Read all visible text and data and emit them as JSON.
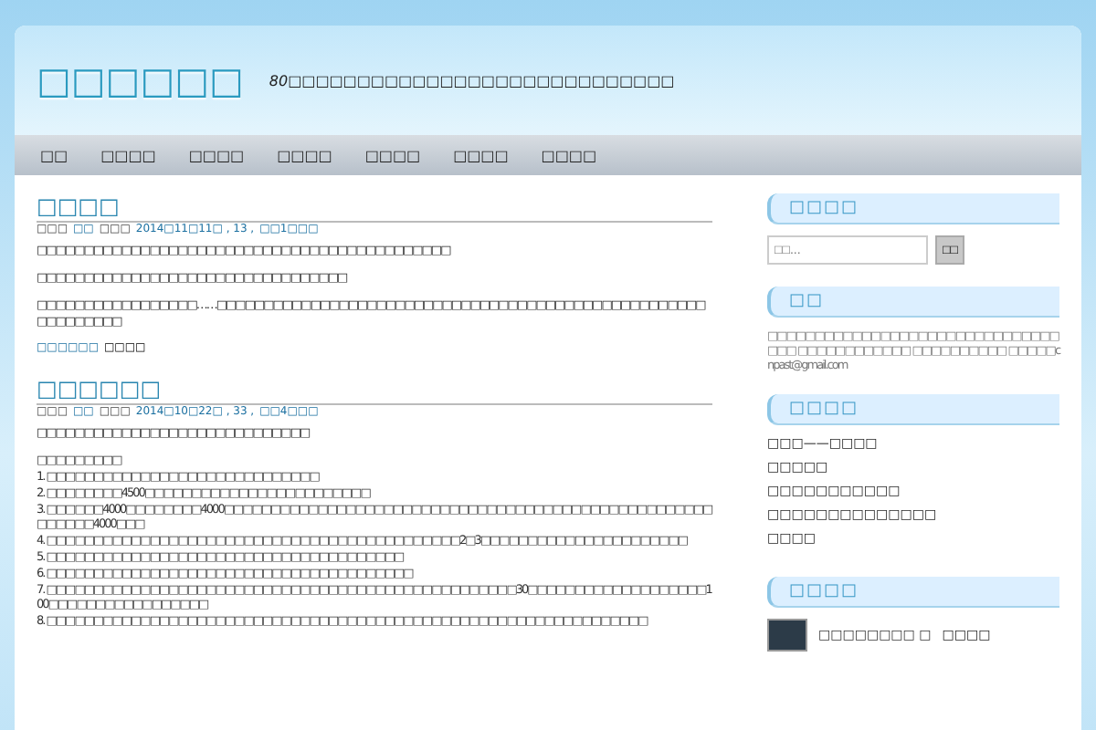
{
  "site": {
    "title": "□□□□□□",
    "tagline": "80□□□□□□□□□□□□□□□□□□□□□□□□□□□□"
  },
  "nav": [
    {
      "label": "□□",
      "selected": false
    },
    {
      "label": "□□□□",
      "selected": false
    },
    {
      "label": "□□□□",
      "selected": false
    },
    {
      "label": "□□□□",
      "selected": false
    },
    {
      "label": "□□□□",
      "selected": false
    },
    {
      "label": "□□□□",
      "selected": false
    },
    {
      "label": "□□□□",
      "selected": false
    }
  ],
  "posts": [
    {
      "title": "□□□□",
      "meta": {
        "by": "□□□",
        "author": "□□",
        "on": "□□□",
        "date": "2014□11□11□ , 13 ,",
        "comments": "□□1□□□"
      },
      "paragraphs": [
        "□□□□□□□□□□□□□□□□□□□□□□□□□□□□□□□□□□□□□□□□□□□□",
        "□□□□□□□□□□□□□□□□□□□□□□□□□□□□□□□□□",
        "□□□□□□□□□□□□□□□□□……□□□□□□□□□□□□□□□□□□□□□□□□□□□□□□□□□□□□□□□□□□□□□□□□□□□□□□□□□□□□□"
      ],
      "more": {
        "link": "□□□□□□",
        "text": "□□□□"
      }
    },
    {
      "title": "□□□□□□",
      "meta": {
        "by": "□□□",
        "author": "□□",
        "on": "□□□",
        "date": "2014□10□22□ , 33 ,",
        "comments": "□□4□□□"
      },
      "paragraphs": [
        "□□□□□□□□□□□□□□□□□□□□□□□□□□□□□"
      ],
      "list_intro": "□□□□□□□□□",
      "list": [
        "1. □□□□□□□□□□□□□□□□□□□□□□□□□□□□□",
        "2. □□□□□□□□4500□□□□□□□□□□□□□□□□□□□□□□□□",
        "3. □□□□□□4000□□□□□□□□4000□□□□□□□□□□□□□□□□□□□□□□□□□□□□□□□□□□□□□□□□□□□□□□□□□□□□□□□□□□4000□□□",
        "4. □□□□□□□□□□□□□□□□□□□□□□□□□□□□□□□□□□□□□□□□□□□□2□3□□□□□□□□□□□□□□□□□□□□□□",
        "5. □□□□□□□□□□□□□□□□□□□□□□□□□□□□□□□□□□□□□□",
        "6. □□□□□□□□□□□□□□□□□□□□□□□□□□□□□□□□□□□□□□□",
        "7. □□□□□□□□□□□□□□□□□□□□□□□□□□□□□□□□□□□□□□□□□□□□□□□□□□30□□□□□□□□□□□□□□□□□□□100□□□□□□□□□□□□□□□□□",
        "8. □□□□□□□□□□□□□□□□□□□□□□□□□□□□□□□□□□□□□□□□□□□□□□□□□□□□□□□□□□□□□□□□"
      ]
    }
  ],
  "sidebar": [
    {
      "kind": "search",
      "title": "□□□□",
      "placeholder": "□□...",
      "button": "□□"
    },
    {
      "kind": "text",
      "title": "□□",
      "text": "□□□□□□□□□□□□□□□□□□□□□□□□□□□□□□□□□□ □□□□□□□□□□□□ □□□□□□□□□□ □□□□□cnpast@gmail.com"
    },
    {
      "kind": "links",
      "title": "□□□□",
      "items": [
        "□□□——□□□□",
        "□□□□□",
        "□□□□□□□□□□□",
        "□□□□□□□□□□□□□□",
        "□□□□"
      ]
    },
    {
      "kind": "recent",
      "title": "□□□□",
      "items": [
        {
          "text": "□□□□□□□□ □",
          "link": "□□□□"
        }
      ]
    }
  ]
}
